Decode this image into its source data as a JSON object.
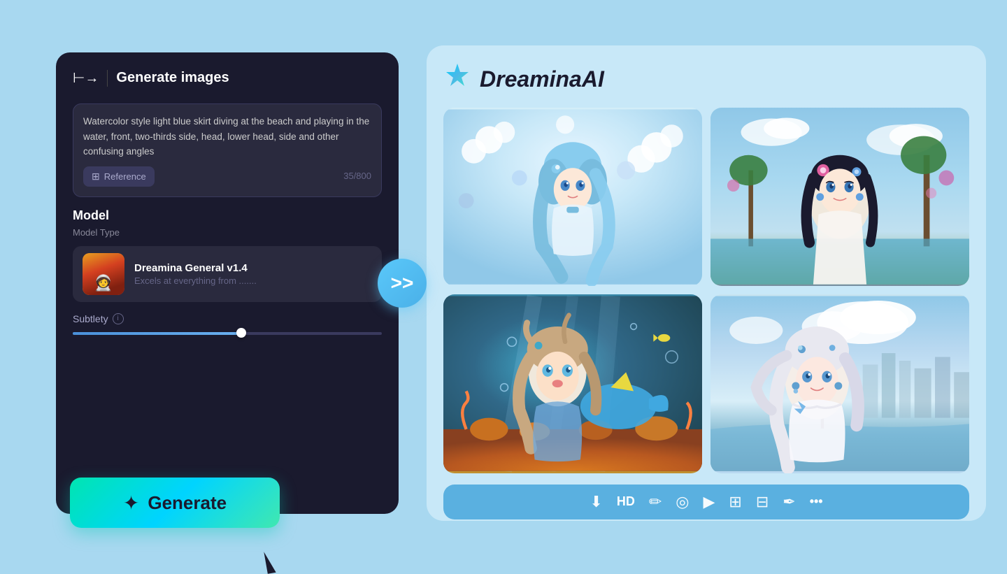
{
  "app": {
    "title": "DreaminaAI",
    "logo": "✦"
  },
  "left_panel": {
    "header": {
      "menu_icon": "⊢→",
      "title": "Generate images"
    },
    "prompt": {
      "text": "Watercolor style light blue skirt diving at the beach and playing in the water, front, two-thirds side, head, lower head, side and other confusing angles",
      "char_count": "35/800"
    },
    "reference_btn": {
      "label": "Reference",
      "icon": "⊞"
    },
    "model": {
      "title": "Model",
      "subtitle": "Model Type",
      "name": "Dreamina General v1.4",
      "description": "Excels at everything from ......."
    },
    "subtlety": {
      "label": "Subtlety",
      "info": "i"
    },
    "generate_btn": {
      "label": "Generate",
      "icon": "✦"
    }
  },
  "right_panel": {
    "title": "DreaminaAI",
    "logo_icon": "🌟",
    "toolbar": {
      "items": [
        {
          "icon": "⬇",
          "name": "download",
          "label": "Download"
        },
        {
          "icon": "HD",
          "name": "hd",
          "label": "HD"
        },
        {
          "icon": "✏",
          "name": "edit",
          "label": "Edit"
        },
        {
          "icon": "◎",
          "name": "style",
          "label": "Style"
        },
        {
          "icon": "▶",
          "name": "animate",
          "label": "Animate"
        },
        {
          "icon": "⊞",
          "name": "extend",
          "label": "Extend"
        },
        {
          "icon": "⊟",
          "name": "resize",
          "label": "Resize"
        },
        {
          "icon": "✒",
          "name": "retouch",
          "label": "Retouch"
        },
        {
          "icon": "•••",
          "name": "more",
          "label": "More"
        }
      ]
    },
    "images": [
      {
        "id": 1,
        "alt": "Anime girl with blue hair and white flowers"
      },
      {
        "id": 2,
        "alt": "Anime girl with dark hair at tropical beach"
      },
      {
        "id": 3,
        "alt": "Anime girl underwater diving with blue creature"
      },
      {
        "id": 4,
        "alt": "Anime girl with white hair at beach with city background"
      }
    ]
  },
  "arrow_btn": {
    "label": ">>"
  }
}
